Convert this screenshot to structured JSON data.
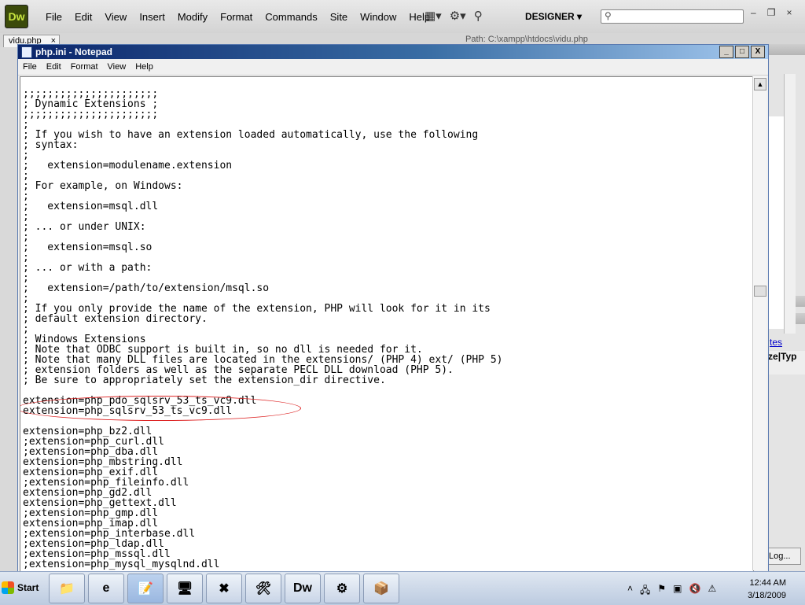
{
  "dreamweaver": {
    "logo": "Dw",
    "menus": [
      "File",
      "Edit",
      "View",
      "Insert",
      "Modify",
      "Format",
      "Commands",
      "Site",
      "Window",
      "Help"
    ],
    "workspace": "DESIGNER",
    "doc_tab": "vidu.php",
    "doc_tab_close": "×",
    "path": "Path: C:\\xampp\\htdocs\\vidu.php",
    "right_panel": {
      "link_text": "tes",
      "col1": "ze",
      "col2": "Typ",
      "log_button": "Log..."
    },
    "window_controls": [
      "–",
      "❐",
      "×"
    ]
  },
  "notepad": {
    "title": "php.ini - Notepad",
    "menus": [
      "File",
      "Edit",
      "Format",
      "View",
      "Help"
    ],
    "lines": [
      ";;;;;;;;;;;;;;;;;;;;;;",
      "; Dynamic Extensions ;",
      ";;;;;;;;;;;;;;;;;;;;;;",
      ";",
      "; If you wish to have an extension loaded automatically, use the following",
      "; syntax:",
      ";",
      ";   extension=modulename.extension",
      ";",
      "; For example, on Windows:",
      ";",
      ";   extension=msql.dll",
      ";",
      "; ... or under UNIX:",
      ";",
      ";   extension=msql.so",
      ";",
      "; ... or with a path:",
      ";",
      ";   extension=/path/to/extension/msql.so",
      ";",
      "; If you only provide the name of the extension, PHP will look for it in its",
      "; default extension directory.",
      ";",
      "; Windows Extensions",
      "; Note that ODBC support is built in, so no dll is needed for it.",
      "; Note that many DLL files are located in the extensions/ (PHP 4) ext/ (PHP 5)",
      "; extension folders as well as the separate PECL DLL download (PHP 5).",
      "; Be sure to appropriately set the extension_dir directive.",
      "",
      "extension=php_pdo_sqlsrv_53_ts_vc9.dll",
      "extension=php_sqlsrv_53_ts_vc9.dll",
      "",
      "extension=php_bz2.dll",
      ";extension=php_curl.dll",
      ";extension=php_dba.dll",
      "extension=php_mbstring.dll",
      "extension=php_exif.dll",
      ";extension=php_fileinfo.dll",
      "extension=php_gd2.dll",
      "extension=php_gettext.dll",
      ";extension=php_gmp.dll",
      "extension=php_imap.dll",
      ";extension=php_interbase.dll",
      ";extension=php_ldap.dll",
      ";extension=php_mssql.dll",
      ";extension=php_mysql_mysqlnd.dll"
    ]
  },
  "taskbar": {
    "start": "Start",
    "apps": [
      {
        "name": "windows-explorer-icon",
        "glyph": "📁"
      },
      {
        "name": "internet-explorer-icon",
        "glyph": "e"
      },
      {
        "name": "notepad-icon",
        "glyph": "📝"
      },
      {
        "name": "remote-desktop-icon",
        "glyph": "🖥"
      },
      {
        "name": "xampp-icon",
        "glyph": "✖"
      },
      {
        "name": "tools-icon",
        "glyph": "🛠"
      },
      {
        "name": "dreamweaver-icon",
        "glyph": "Dw"
      },
      {
        "name": "control-panel-icon",
        "glyph": "⚙"
      },
      {
        "name": "installer-icon",
        "glyph": "📦"
      }
    ],
    "time": "12:44 AM",
    "date": "3/18/2009"
  }
}
